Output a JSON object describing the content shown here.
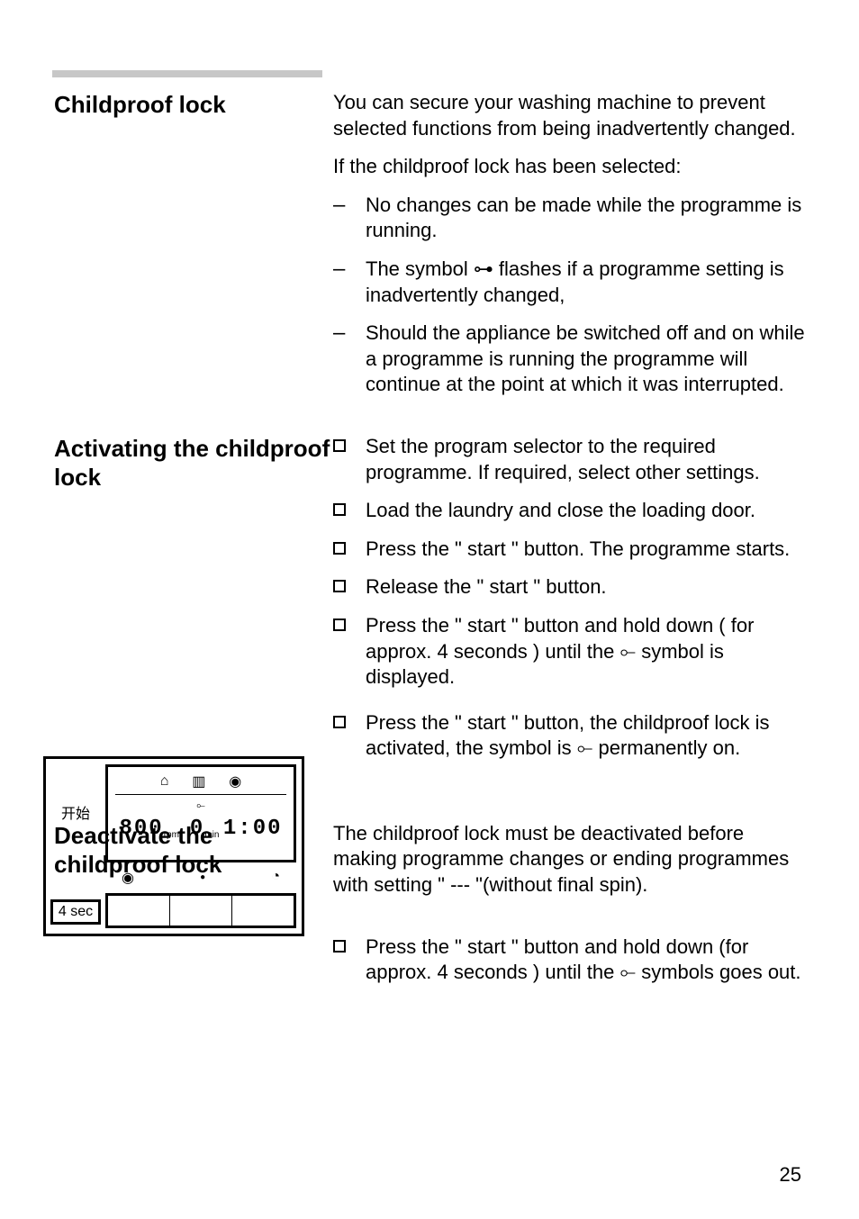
{
  "sections": {
    "childproof": {
      "title": "Childproof lock",
      "intro": "You can secure your washing machine to prevent selected functions from being inadvertently changed.",
      "selected_lead": "If the childproof lock has been selected:",
      "bullets": [
        "No changes can be made while the programme is running.",
        "The symbol  ⊶  flashes if a programme setting is inadvertently changed,",
        "Should the appliance be switched off and on while a programme is running the programme will continue at the point at which it was interrupted."
      ]
    },
    "activating": {
      "title": "Activating the childproof lock",
      "steps": [
        "Set the program selector to the required programme. If required, select other settings.",
        "Load the laundry and close the loading door.",
        "Press the \" start \" button. The programme starts.",
        "Release the \" start \" button.",
        "Press the \" start \" button and hold down ( for approx. 4 seconds ) until the ⟜ symbol is displayed.",
        "Press the \" start \" button, the childproof lock is activated, the symbol is ⟜  permanently on."
      ]
    },
    "deactivate": {
      "title": "Deactivate the childproof lock",
      "intro": "The childproof lock must be deactivated before making programme changes or ending programmes with setting \" --- \"(without final spin).",
      "step": "Press the \" start \" button and hold down (for approx. 4 seconds ) until the ⟜ symbols goes out."
    }
  },
  "diagram": {
    "label_start": "开始",
    "label_4sec": "4 sec",
    "seg_left": "800",
    "seg_left_unit": "rpm",
    "seg_right_pre": "0",
    "seg_right_unit": "min",
    "seg_right": "1:00",
    "icon_bucket": "⌂",
    "icon_tub": "▥",
    "icon_spin": "◉",
    "icon_circle_dot": "◉",
    "icon_clock": "◔",
    "icon_key": "⟜"
  },
  "page": "25"
}
